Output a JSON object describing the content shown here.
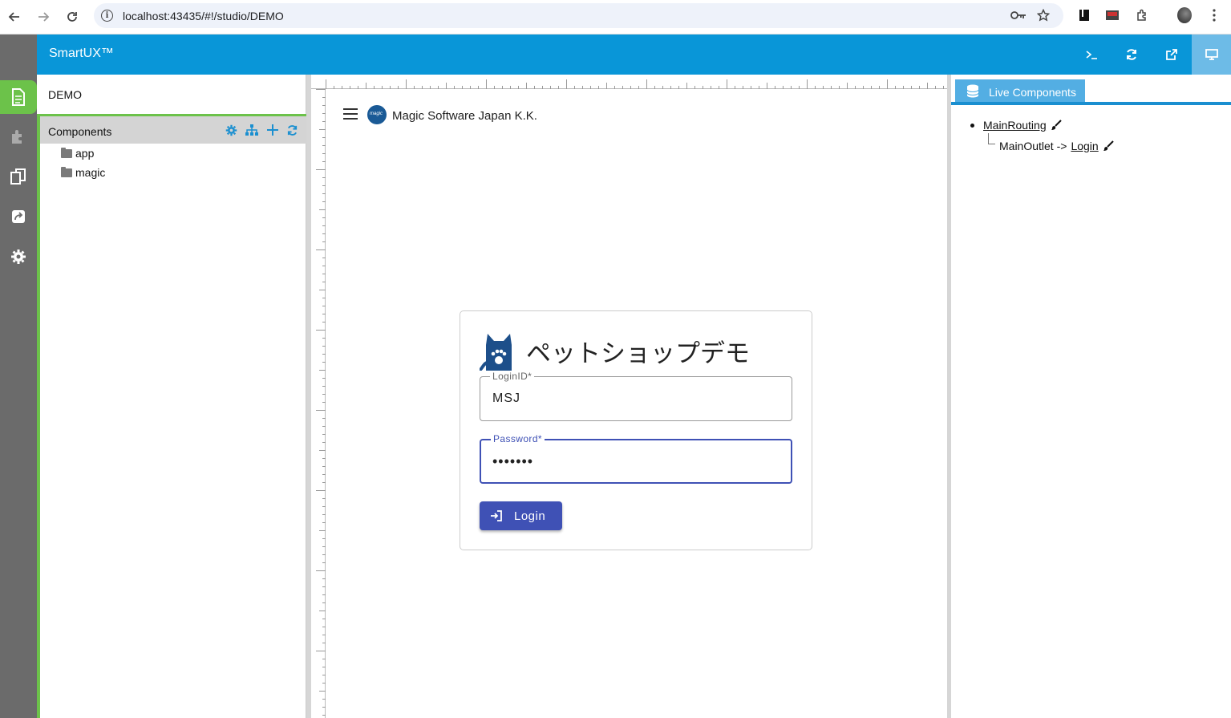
{
  "browser": {
    "url": "localhost:43435/#!/studio/DEMO"
  },
  "app": {
    "title": "SmartUX™",
    "accent_color": "#0996d8",
    "green_accent": "#6cc24a"
  },
  "sidebar": {
    "items": [
      {
        "icon": "file-icon",
        "active": true
      },
      {
        "icon": "puzzle-icon",
        "active": false
      },
      {
        "icon": "copy-icon",
        "active": false
      },
      {
        "icon": "share-icon",
        "active": false
      },
      {
        "icon": "gear-icon",
        "active": false
      }
    ]
  },
  "project": {
    "name": "DEMO",
    "components_title": "Components",
    "tree": [
      "app",
      "magic"
    ]
  },
  "canvas": {
    "brand_name": "Magic Software Japan K.K.",
    "shop_title": "ペットショップデモ",
    "login_label": "LoginID*",
    "login_value": "MSJ",
    "password_label": "Password*",
    "password_value": "•••••••",
    "login_button": "Login",
    "primary_color": "#3f51b5"
  },
  "live_components": {
    "tab_label": "Live Components",
    "root": "MainRouting",
    "child_prefix": "MainOutlet ->",
    "child_link": "Login"
  }
}
